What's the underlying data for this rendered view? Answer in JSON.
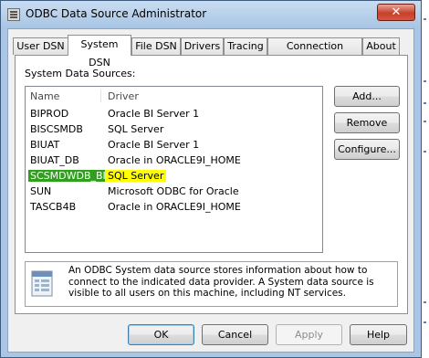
{
  "window": {
    "title": "ODBC Data Source Administrator",
    "close_label": "✕"
  },
  "tabs": [
    {
      "label": "User DSN",
      "active": false
    },
    {
      "label": "System DSN",
      "active": true
    },
    {
      "label": "File DSN",
      "active": false
    },
    {
      "label": "Drivers",
      "active": false
    },
    {
      "label": "Tracing",
      "active": false
    },
    {
      "label": "Connection Pooling",
      "active": false
    },
    {
      "label": "About",
      "active": false
    }
  ],
  "panel": {
    "section_label": "System Data Sources:",
    "columns": {
      "name": "Name",
      "driver": "Driver"
    },
    "rows": [
      {
        "name": "BIPROD",
        "driver": "Oracle BI Server 1"
      },
      {
        "name": "BISCSMDB",
        "driver": "SQL Server"
      },
      {
        "name": "BIUAT",
        "driver": "Oracle BI Server 1"
      },
      {
        "name": "BIUAT_DB",
        "driver": "Oracle in ORACLE9I_HOME"
      },
      {
        "name": "SCSMDWDB_BI",
        "driver": "SQL Server",
        "highlighted": true
      },
      {
        "name": "SUN",
        "driver": "Microsoft ODBC for Oracle"
      },
      {
        "name": "TASCB4B",
        "driver": "Oracle in ORACLE9I_HOME"
      }
    ],
    "buttons": {
      "add": "Add...",
      "remove": "Remove",
      "configure": "Configure..."
    },
    "info_text": "An ODBC System data source stores information about how to connect to the indicated data provider.   A System data source is visible to all users on this machine, including NT services."
  },
  "footer": {
    "ok": "OK",
    "cancel": "Cancel",
    "apply": "Apply",
    "help": "Help"
  },
  "colors": {
    "name_highlight": "#2ea01b",
    "driver_highlight": "#ffff00"
  }
}
